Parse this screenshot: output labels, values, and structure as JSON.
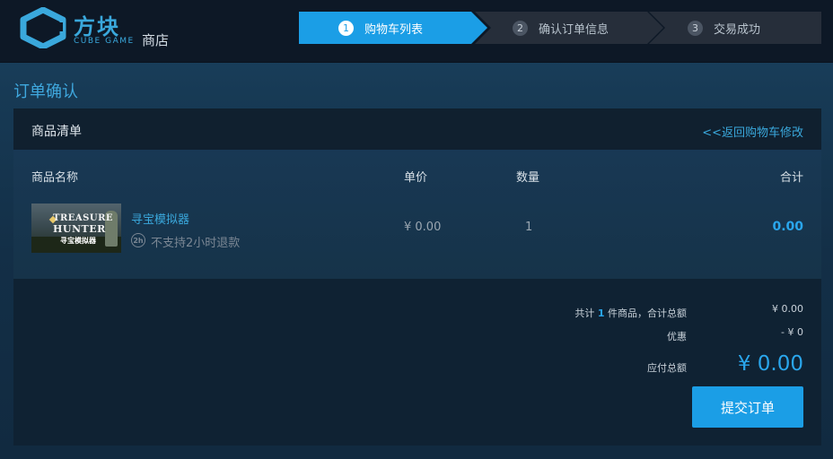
{
  "header": {
    "logo_text": "方块",
    "logo_sub": "CUBE GAME",
    "shop_label": "商店",
    "steps": [
      {
        "num": "1",
        "label": "购物车列表",
        "active": true
      },
      {
        "num": "2",
        "label": "确认订单信息",
        "active": false
      },
      {
        "num": "3",
        "label": "交易成功",
        "active": false
      }
    ]
  },
  "page_title": "订单确认",
  "panel": {
    "title": "商品清单",
    "back_link": "<<返回购物车修改",
    "columns": {
      "name": "商品名称",
      "price": "单价",
      "qty": "数量",
      "total": "合计"
    },
    "items": [
      {
        "thumb_line1": "TREASURE",
        "thumb_line2": "HUNTER",
        "thumb_line3": "寻宝模拟器",
        "name": "寻宝模拟器",
        "refund_icon": "2h",
        "refund_note": "不支持2小时退款",
        "price": "¥ 0.00",
        "qty": "1",
        "total": "0.00"
      }
    ]
  },
  "summary": {
    "count_prefix": "共计",
    "count": "1",
    "count_suffix": "件商品，合计总额",
    "subtotal": "¥ 0.00",
    "discount_label": "优惠",
    "discount": "- ¥ 0",
    "payable_label": "应付总额",
    "payable": "¥ 0.00",
    "submit_label": "提交订单"
  },
  "colors": {
    "accent": "#1b9ee6",
    "link": "#3aa8dc",
    "header_bg": "#0d1826",
    "step_inactive": "#262e3a"
  }
}
